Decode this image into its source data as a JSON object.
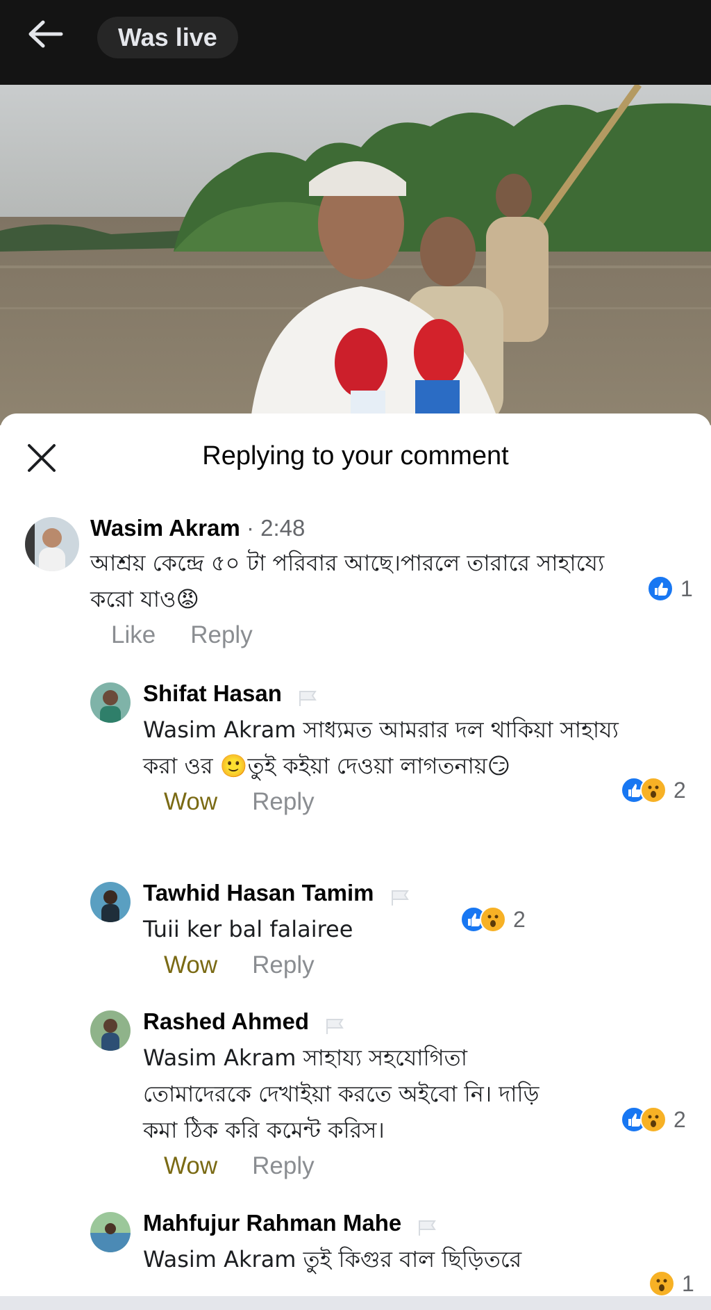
{
  "topbar": {
    "live_label": "Was live",
    "back_icon": "back-arrow-icon"
  },
  "sheet": {
    "title": "Replying to your comment",
    "close_icon": "close-icon"
  },
  "colors": {
    "like_blue": "#1877f2",
    "wow_yellow": "#f7b125",
    "wow_text": "#7a6a14"
  },
  "comments": [
    {
      "name": "Wasim Akram",
      "time": "· 2:48",
      "text": "আশ্রয় কেন্দ্রে ৫০ টা পরিবার আছে।পারলে তারারে সাহায্যে করো যাও😡",
      "actions": [
        "Like",
        "Reply"
      ],
      "reactions": {
        "types": [
          "like"
        ],
        "count": "1"
      }
    },
    {
      "name": "Shifat Hasan",
      "text": "Wasim Akram সাধ্যমত আমরার দল থাকিয়া সাহায্য করা ওর 🙂তুই কইয়া দেওয়া লাগতনায়😏",
      "actions": [
        "Wow",
        "Reply"
      ],
      "reactions": {
        "types": [
          "like",
          "wow"
        ],
        "count": "2"
      }
    },
    {
      "name": "Tawhid Hasan Tamim",
      "text": "Tuii ker bal falairee",
      "actions": [
        "Wow",
        "Reply"
      ],
      "reactions": {
        "types": [
          "like",
          "wow"
        ],
        "count": "2"
      }
    },
    {
      "name": "Rashed Ahmed",
      "text": "Wasim Akram সাহায্য সহযোগিতা তোমাদেরকে দেখাইয়া করতে অইবো নি। দাড়ি কমা ঠিক করি কমেন্ট করিস।",
      "actions": [
        "Wow",
        "Reply"
      ],
      "reactions": {
        "types": [
          "like",
          "wow"
        ],
        "count": "2"
      }
    },
    {
      "name": "Mahfujur Rahman Mahe",
      "text": "Wasim Akram তুই কিগুর বাল ছিড়িতরে",
      "actions": [],
      "reactions": {
        "types": [
          "wow"
        ],
        "count": "1"
      }
    }
  ]
}
